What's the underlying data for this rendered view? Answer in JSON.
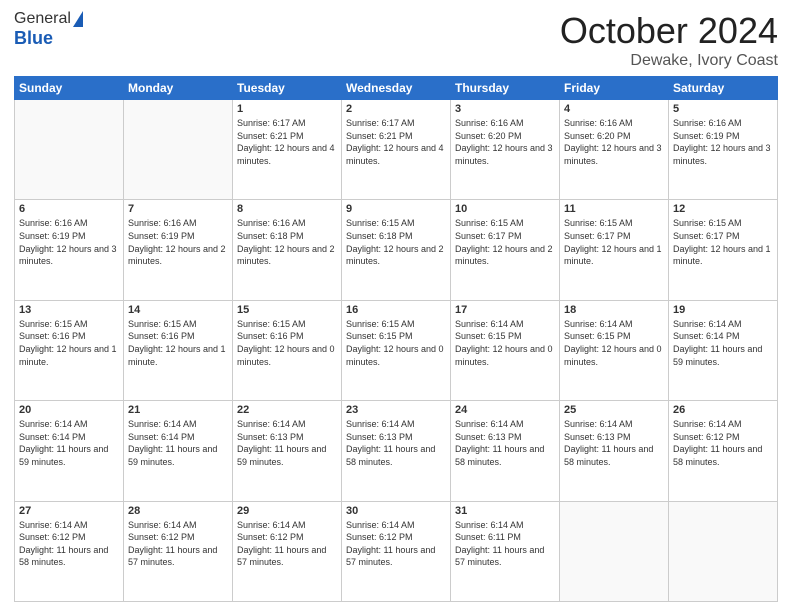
{
  "header": {
    "logo_general": "General",
    "logo_blue": "Blue",
    "month_title": "October 2024",
    "location": "Dewake, Ivory Coast"
  },
  "weekdays": [
    "Sunday",
    "Monday",
    "Tuesday",
    "Wednesday",
    "Thursday",
    "Friday",
    "Saturday"
  ],
  "weeks": [
    [
      {
        "day": "",
        "info": ""
      },
      {
        "day": "",
        "info": ""
      },
      {
        "day": "1",
        "info": "Sunrise: 6:17 AM\nSunset: 6:21 PM\nDaylight: 12 hours and 4 minutes."
      },
      {
        "day": "2",
        "info": "Sunrise: 6:17 AM\nSunset: 6:21 PM\nDaylight: 12 hours and 4 minutes."
      },
      {
        "day": "3",
        "info": "Sunrise: 6:16 AM\nSunset: 6:20 PM\nDaylight: 12 hours and 3 minutes."
      },
      {
        "day": "4",
        "info": "Sunrise: 6:16 AM\nSunset: 6:20 PM\nDaylight: 12 hours and 3 minutes."
      },
      {
        "day": "5",
        "info": "Sunrise: 6:16 AM\nSunset: 6:19 PM\nDaylight: 12 hours and 3 minutes."
      }
    ],
    [
      {
        "day": "6",
        "info": "Sunrise: 6:16 AM\nSunset: 6:19 PM\nDaylight: 12 hours and 3 minutes."
      },
      {
        "day": "7",
        "info": "Sunrise: 6:16 AM\nSunset: 6:19 PM\nDaylight: 12 hours and 2 minutes."
      },
      {
        "day": "8",
        "info": "Sunrise: 6:16 AM\nSunset: 6:18 PM\nDaylight: 12 hours and 2 minutes."
      },
      {
        "day": "9",
        "info": "Sunrise: 6:15 AM\nSunset: 6:18 PM\nDaylight: 12 hours and 2 minutes."
      },
      {
        "day": "10",
        "info": "Sunrise: 6:15 AM\nSunset: 6:17 PM\nDaylight: 12 hours and 2 minutes."
      },
      {
        "day": "11",
        "info": "Sunrise: 6:15 AM\nSunset: 6:17 PM\nDaylight: 12 hours and 1 minute."
      },
      {
        "day": "12",
        "info": "Sunrise: 6:15 AM\nSunset: 6:17 PM\nDaylight: 12 hours and 1 minute."
      }
    ],
    [
      {
        "day": "13",
        "info": "Sunrise: 6:15 AM\nSunset: 6:16 PM\nDaylight: 12 hours and 1 minute."
      },
      {
        "day": "14",
        "info": "Sunrise: 6:15 AM\nSunset: 6:16 PM\nDaylight: 12 hours and 1 minute."
      },
      {
        "day": "15",
        "info": "Sunrise: 6:15 AM\nSunset: 6:16 PM\nDaylight: 12 hours and 0 minutes."
      },
      {
        "day": "16",
        "info": "Sunrise: 6:15 AM\nSunset: 6:15 PM\nDaylight: 12 hours and 0 minutes."
      },
      {
        "day": "17",
        "info": "Sunrise: 6:14 AM\nSunset: 6:15 PM\nDaylight: 12 hours and 0 minutes."
      },
      {
        "day": "18",
        "info": "Sunrise: 6:14 AM\nSunset: 6:15 PM\nDaylight: 12 hours and 0 minutes."
      },
      {
        "day": "19",
        "info": "Sunrise: 6:14 AM\nSunset: 6:14 PM\nDaylight: 11 hours and 59 minutes."
      }
    ],
    [
      {
        "day": "20",
        "info": "Sunrise: 6:14 AM\nSunset: 6:14 PM\nDaylight: 11 hours and 59 minutes."
      },
      {
        "day": "21",
        "info": "Sunrise: 6:14 AM\nSunset: 6:14 PM\nDaylight: 11 hours and 59 minutes."
      },
      {
        "day": "22",
        "info": "Sunrise: 6:14 AM\nSunset: 6:13 PM\nDaylight: 11 hours and 59 minutes."
      },
      {
        "day": "23",
        "info": "Sunrise: 6:14 AM\nSunset: 6:13 PM\nDaylight: 11 hours and 58 minutes."
      },
      {
        "day": "24",
        "info": "Sunrise: 6:14 AM\nSunset: 6:13 PM\nDaylight: 11 hours and 58 minutes."
      },
      {
        "day": "25",
        "info": "Sunrise: 6:14 AM\nSunset: 6:13 PM\nDaylight: 11 hours and 58 minutes."
      },
      {
        "day": "26",
        "info": "Sunrise: 6:14 AM\nSunset: 6:12 PM\nDaylight: 11 hours and 58 minutes."
      }
    ],
    [
      {
        "day": "27",
        "info": "Sunrise: 6:14 AM\nSunset: 6:12 PM\nDaylight: 11 hours and 58 minutes."
      },
      {
        "day": "28",
        "info": "Sunrise: 6:14 AM\nSunset: 6:12 PM\nDaylight: 11 hours and 57 minutes."
      },
      {
        "day": "29",
        "info": "Sunrise: 6:14 AM\nSunset: 6:12 PM\nDaylight: 11 hours and 57 minutes."
      },
      {
        "day": "30",
        "info": "Sunrise: 6:14 AM\nSunset: 6:12 PM\nDaylight: 11 hours and 57 minutes."
      },
      {
        "day": "31",
        "info": "Sunrise: 6:14 AM\nSunset: 6:11 PM\nDaylight: 11 hours and 57 minutes."
      },
      {
        "day": "",
        "info": ""
      },
      {
        "day": "",
        "info": ""
      }
    ]
  ]
}
